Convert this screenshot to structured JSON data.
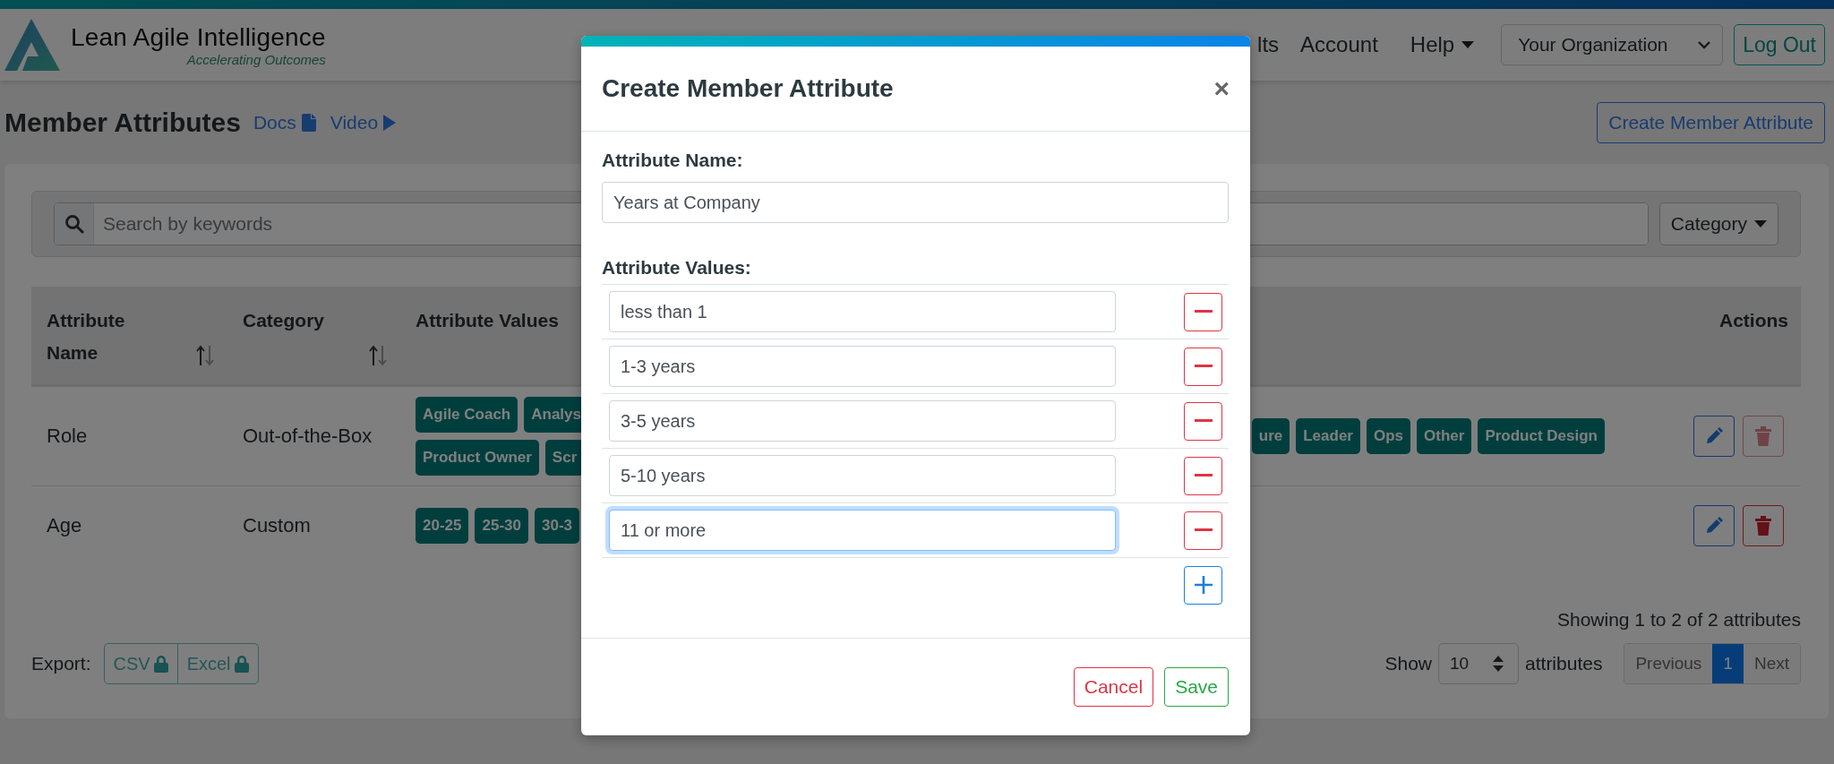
{
  "top_nav": {
    "logo_title": "Lean Agile Intelligence",
    "logo_tagline": "Accelerating Outcomes",
    "links": [
      {
        "label": "lts",
        "kind": "link"
      },
      {
        "label": "Account",
        "kind": "link"
      },
      {
        "label": "Help",
        "kind": "dropdown"
      }
    ],
    "organization_select": "Your Organization",
    "logout_button": "Log Out"
  },
  "page_header": {
    "title": "Member Attributes",
    "links": [
      {
        "label": "Docs",
        "kind": "doc"
      },
      {
        "label": "Video",
        "kind": "video"
      }
    ],
    "create_button": "Create Member Attribute"
  },
  "search": {
    "placeholder": "Search by keywords",
    "category_button": "Category"
  },
  "table": {
    "columns": [
      {
        "label": "Attribute Name",
        "sortable": true
      },
      {
        "label": "Category",
        "sortable": true
      },
      {
        "label": "Attribute Values",
        "sortable": false
      },
      {
        "label": "Actions",
        "sortable": false
      }
    ],
    "rows": [
      {
        "name": "Role",
        "category": "Out-of-the-Box",
        "values_left": [
          [
            "Agile Coach",
            "Analys"
          ],
          [
            "Product Owner",
            "Scr"
          ]
        ],
        "values_right": [
          [
            "ure",
            "Leader",
            "Ops",
            "Other",
            "Product Design"
          ]
        ],
        "delete_disabled": true
      },
      {
        "name": "Age",
        "category": "Custom",
        "values_left": [
          [
            "20-25",
            "25-30",
            "30-3"
          ]
        ],
        "values_right": [],
        "delete_disabled": false
      }
    ]
  },
  "footer": {
    "summary": "Showing 1 to 2 of 2 attributes",
    "export_label": "Export:",
    "export_buttons": [
      {
        "label": "CSV",
        "locked": true
      },
      {
        "label": "Excel",
        "locked": true
      }
    ],
    "show_label": "Show",
    "page_size": "10",
    "page_size_suffix": "attributes",
    "pagination": [
      {
        "label": "Previous",
        "selected": false
      },
      {
        "label": "1",
        "selected": true
      },
      {
        "label": "Next",
        "selected": false
      }
    ]
  },
  "modal": {
    "title": "Create Member Attribute",
    "close": "×",
    "name_label": "Attribute Name:",
    "name_value": "Years at Company",
    "values_label": "Attribute Values:",
    "values": [
      {
        "value": "less than 1",
        "focused": false
      },
      {
        "value": "1-3 years",
        "focused": false
      },
      {
        "value": "3-5 years",
        "focused": false
      },
      {
        "value": "5-10 years",
        "focused": false
      },
      {
        "value": "11 or more",
        "focused": true
      }
    ],
    "buttons": [
      {
        "label": "Cancel",
        "kind": "cancel"
      },
      {
        "label": "Save",
        "kind": "save"
      }
    ]
  }
}
